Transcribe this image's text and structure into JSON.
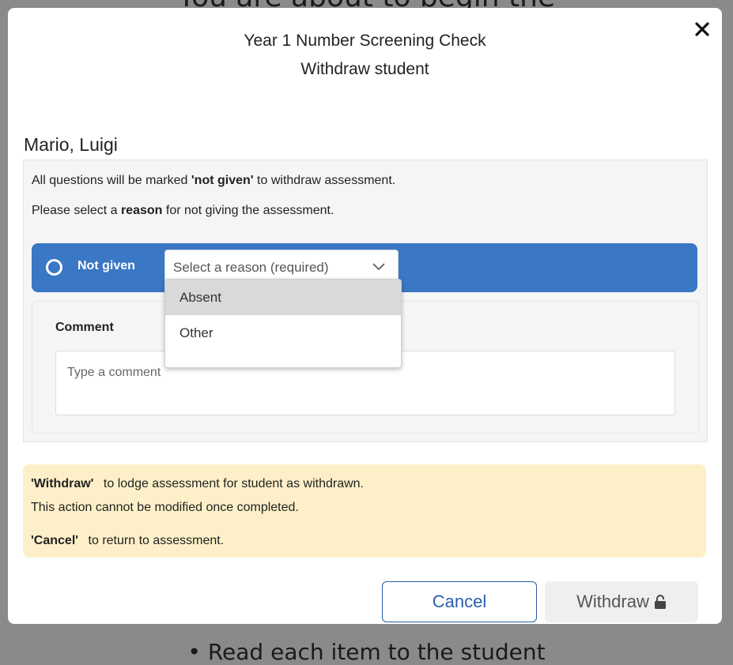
{
  "background": {
    "top_text": "You are about to begin the",
    "bottom_text": "• Read each item to the student"
  },
  "modal": {
    "title_line1": "Year 1 Number Screening Check",
    "title_line2": "Withdraw student",
    "close_icon": "close-icon"
  },
  "student": {
    "name": "Mario, Luigi"
  },
  "info": {
    "line1_prefix": "All questions will be marked ",
    "line1_bold": "'not given'",
    "line1_suffix": " to withdraw assessment.",
    "line2_prefix": "Please select a ",
    "line2_bold": "reason",
    "line2_suffix": " for not giving the assessment."
  },
  "not_given": {
    "label": "Not given",
    "selected": false,
    "select_placeholder": "Select a reason (required)",
    "options": [
      "Absent",
      "Other"
    ],
    "highlighted_option": "Absent"
  },
  "comment": {
    "label": "Comment",
    "placeholder": "Type a comment"
  },
  "notice": {
    "withdraw_bold": "'Withdraw'",
    "withdraw_text": "to lodge assessment for student as withdrawn.",
    "withdraw_text2": "This action cannot be modified once completed.",
    "cancel_bold": "'Cancel'",
    "cancel_text": "to return to assessment."
  },
  "buttons": {
    "cancel_label": "Cancel",
    "withdraw_label": "Withdraw",
    "withdraw_icon": "unlock-icon",
    "withdraw_enabled": false
  },
  "colors": {
    "primary_blue": "#3a77c4",
    "cancel_blue": "#2b5ea7",
    "notice_bg": "#fdf0c8",
    "overlay_gray": "#8a8a8a"
  }
}
